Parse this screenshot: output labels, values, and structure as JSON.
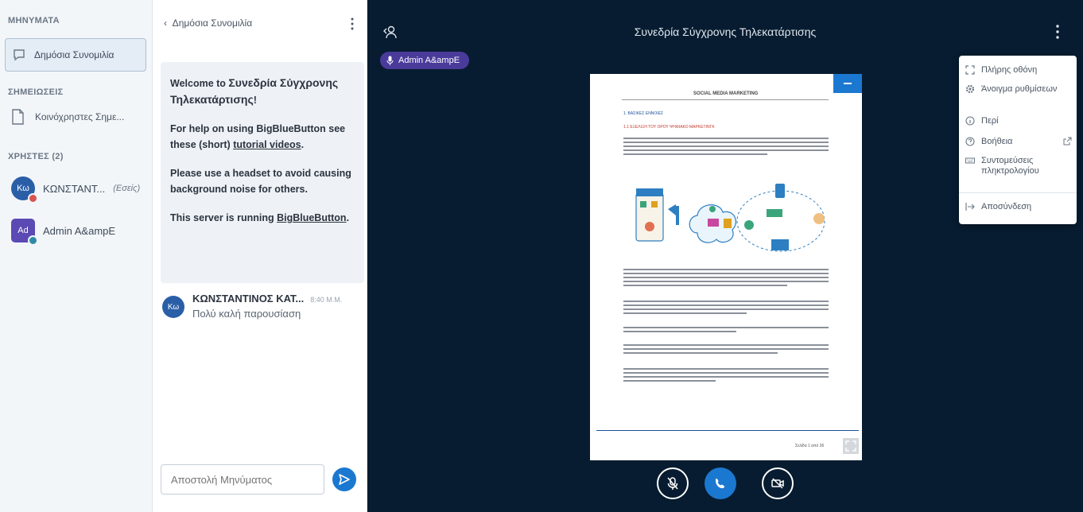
{
  "sidebar": {
    "messages_title": "ΜΗΝΥΜΑΤΑ",
    "public_chat_label": "Δημόσια Συνομιλία",
    "notes_title": "ΣΗΜΕΙΩΣΕΙΣ",
    "shared_notes_label": "Κοινόχρηστες Σημε...",
    "users_title": "ΧΡΗΣΤΕΣ (2)",
    "users": [
      {
        "initials": "Κω",
        "name": "ΚΩΝΣΤΑΝΤ...",
        "role": "(Εσείς)"
      },
      {
        "initials": "Ad",
        "name": "Admin A&ampE",
        "role": ""
      }
    ]
  },
  "chat": {
    "header_title": "Δημόσια Συνομιλία",
    "welcome": {
      "line1_prefix": "Welcome to ",
      "line1_bold": "Συνεδρία Σύγχρονης Τηλεκατάρτισης",
      "line1_suffix": "!",
      "line2_prefix": "For help on using BigBlueButton see these (short) ",
      "line2_link": "tutorial videos",
      "line2_suffix": ".",
      "line3": "Please use a headset to avoid causing background noise for others.",
      "line4_prefix": "This server is running ",
      "line4_link": "BigBlueButton",
      "line4_suffix": "."
    },
    "message": {
      "initials": "Κω",
      "sender": "ΚΩΝΣΤΑΝΤΙΝΟΣ ΚΑΤ...",
      "time": "8:40 Μ.Μ.",
      "text": "Πολύ καλή παρουσίαση"
    },
    "input_placeholder": "Αποστολή Μηνύματος"
  },
  "main": {
    "title": "Συνεδρία Σύγχρονης Τηλεκατάρτισης",
    "talking_indicator": "Admin A&ampE",
    "slide": {
      "header": "SOCIAL MEDIA MARKETING",
      "section": "1. ΒΑΣΙΚΕΣ ΕΝΝΟΙΕΣ",
      "subsection": "1.1 ΕΞΕΛΙΞΗ ΤΟΥ ΟΡΟΥ ΨΗΦΙΑΚΟ ΜΑΡΚΕΤΙΝΓΚ",
      "page_label": "Σελίδα 1 από 36"
    },
    "menu": {
      "fullscreen": "Πλήρης οθόνη",
      "settings": "Άνοιγμα ρυθμίσεων",
      "about": "Περί",
      "help": "Βοήθεια",
      "shortcuts": "Συντομεύσεις πληκτρολογίου",
      "logout": "Αποσύνδεση"
    }
  },
  "colors": {
    "accent": "#1b78d0",
    "dark_bg": "#071c30",
    "talking": "#4a3a9a"
  }
}
